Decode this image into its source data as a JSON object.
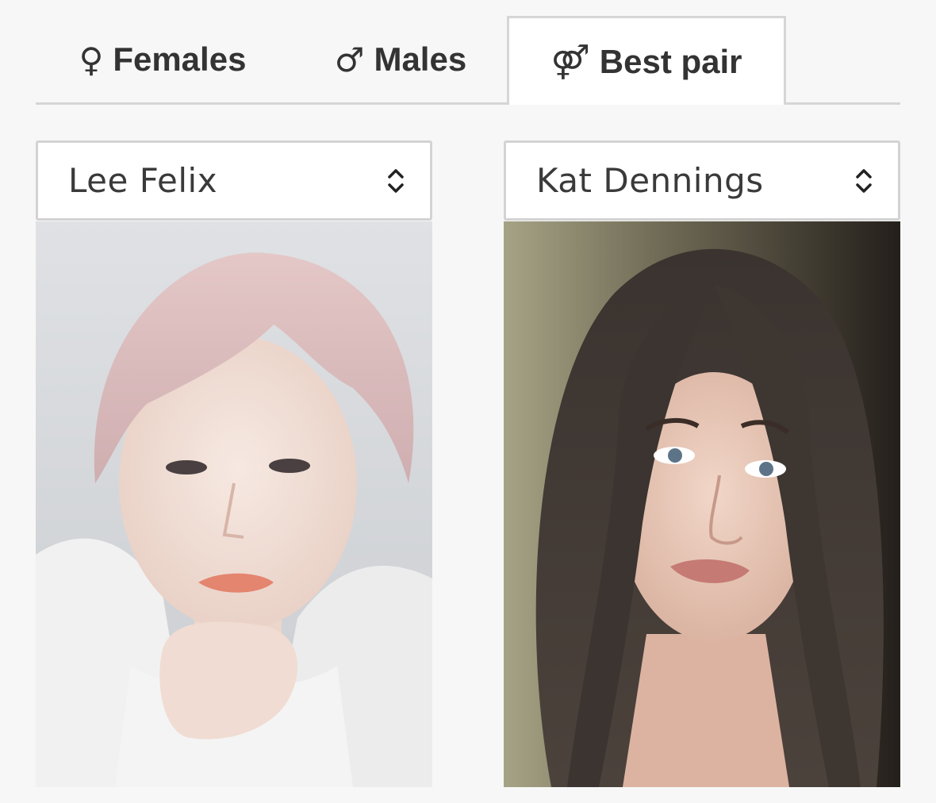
{
  "tabs": [
    {
      "icon": "♀",
      "label": "Females",
      "active": false
    },
    {
      "icon": "♂",
      "label": "Males",
      "active": false
    },
    {
      "icon": "⚤",
      "label": "Best pair",
      "active": true
    }
  ],
  "pair": {
    "left": {
      "name": "Lee Felix",
      "photo_icon": "portrait-photo"
    },
    "right": {
      "name": "Kat Dennings",
      "photo_icon": "portrait-photo"
    }
  },
  "colors": {
    "accent_text": "#333333",
    "border": "#d6d6d6",
    "background": "#f7f7f7"
  }
}
